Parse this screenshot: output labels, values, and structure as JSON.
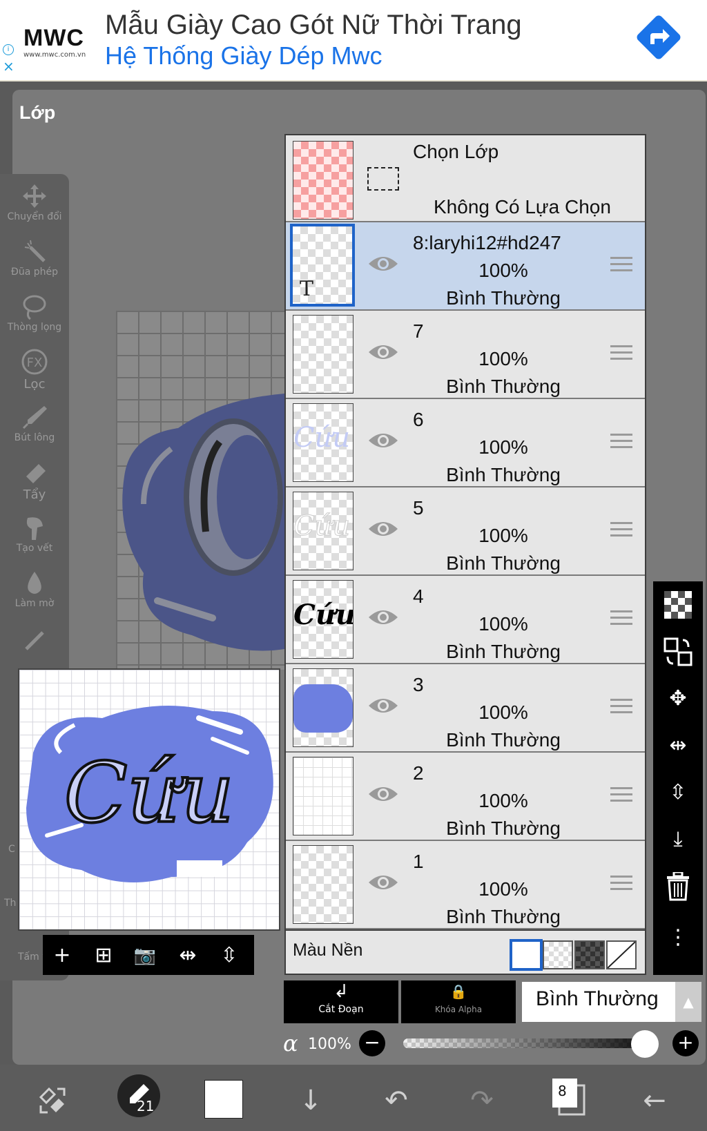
{
  "ad": {
    "logo": "MWC",
    "logo_sub": "www.mwc.com.vn",
    "title": "Mẫu Giày Cao Gót Nữ Thời Trang",
    "subtitle": "Hệ Thống Giày Dép Mwc",
    "info_icon": "i",
    "close_icon": "×",
    "brand_color": "#1a73e8"
  },
  "panel": {
    "title": "Lớp"
  },
  "tools": [
    {
      "label": "Chuyển đổi",
      "icon": "move-icon"
    },
    {
      "label": "Đũa phép",
      "icon": "magic-wand-icon"
    },
    {
      "label": "Thòng lọng",
      "icon": "lasso-icon"
    },
    {
      "label": "Lọc",
      "icon": "fx-icon",
      "glyph": "FX"
    },
    {
      "label": "Bút lông",
      "icon": "brush-icon"
    },
    {
      "label": "Tẩy",
      "icon": "eraser-icon"
    },
    {
      "label": "Tạo vết",
      "icon": "smudge-icon"
    },
    {
      "label": "Làm mờ",
      "icon": "blur-icon"
    }
  ],
  "partial_labels": {
    "left1": "C",
    "left2": "Th",
    "left3": "Tấm v"
  },
  "preview_bar": [
    {
      "icon": "plus-icon",
      "glyph": "+"
    },
    {
      "icon": "add-layer-icon",
      "glyph": "⊞"
    },
    {
      "icon": "camera-icon",
      "glyph": "📷"
    },
    {
      "icon": "flip-horizontal-icon",
      "glyph": "⇹"
    },
    {
      "icon": "flip-vertical-icon",
      "glyph": "⇳"
    }
  ],
  "selection_row": {
    "title": "Chọn Lớp",
    "subtitle": "Không Có Lựa Chọn"
  },
  "layers": [
    {
      "name": "8:laryhi12#hd247",
      "opacity": "100%",
      "mode": "Bình Thường",
      "selected": true,
      "thumb": "text"
    },
    {
      "name": "7",
      "opacity": "100%",
      "mode": "Bình Thường",
      "selected": false,
      "thumb": "empty"
    },
    {
      "name": "6",
      "opacity": "100%",
      "mode": "Bình Thường",
      "selected": false,
      "thumb": "light-text"
    },
    {
      "name": "5",
      "opacity": "100%",
      "mode": "Bình Thường",
      "selected": false,
      "thumb": "outline-text"
    },
    {
      "name": "4",
      "opacity": "100%",
      "mode": "Bình Thường",
      "selected": false,
      "thumb": "black-text"
    },
    {
      "name": "3",
      "opacity": "100%",
      "mode": "Bình Thường",
      "selected": false,
      "thumb": "blob"
    },
    {
      "name": "2",
      "opacity": "100%",
      "mode": "Bình Thường",
      "selected": false,
      "thumb": "grid"
    },
    {
      "name": "1",
      "opacity": "100%",
      "mode": "Bình Thường",
      "selected": false,
      "thumb": "empty"
    }
  ],
  "thumb_texts": {
    "text_layer": "T",
    "cuu": "Cứu"
  },
  "background_row": {
    "label": "Màu Nền"
  },
  "right_tools": [
    {
      "icon": "checker-icon"
    },
    {
      "icon": "transform-icon"
    },
    {
      "icon": "move-arrows-icon",
      "glyph": "✥"
    },
    {
      "icon": "flip-icon",
      "glyph": "⇹"
    },
    {
      "icon": "flip-v-icon",
      "glyph": "⇳"
    },
    {
      "icon": "merge-down-icon",
      "glyph": "⤓"
    },
    {
      "icon": "trash-icon",
      "glyph": "🗑"
    },
    {
      "icon": "more-icon",
      "glyph": "⋮"
    }
  ],
  "layer_buttons": {
    "clipping": {
      "label": "Cắt Đoạn",
      "glyph": "↲"
    },
    "alpha_lock": {
      "label": "Khóa Alpha",
      "glyph": "🔒"
    },
    "blend_mode": "Bình Thường",
    "blend_caret": "▲"
  },
  "opacity": {
    "symbol": "α",
    "value": "100%",
    "minus": "−",
    "plus": "+",
    "level": 1.0
  },
  "bottom_bar": {
    "layer_count": "8",
    "brush_size": "21",
    "color_swatch": "#ffffff",
    "items": [
      {
        "icon": "transform-tool-icon",
        "glyph": "⤡"
      },
      {
        "icon": "brush-size-icon"
      },
      {
        "icon": "color-swatch"
      },
      {
        "icon": "arrow-down-icon",
        "glyph": "↓"
      },
      {
        "icon": "undo-icon",
        "glyph": "↶"
      },
      {
        "icon": "redo-icon",
        "glyph": "↷"
      },
      {
        "icon": "layers-icon"
      },
      {
        "icon": "back-icon",
        "glyph": "←"
      }
    ]
  },
  "colors": {
    "selection": "#c6d6ec",
    "accent": "#1f63c8",
    "blob": "#6d7fe0"
  }
}
